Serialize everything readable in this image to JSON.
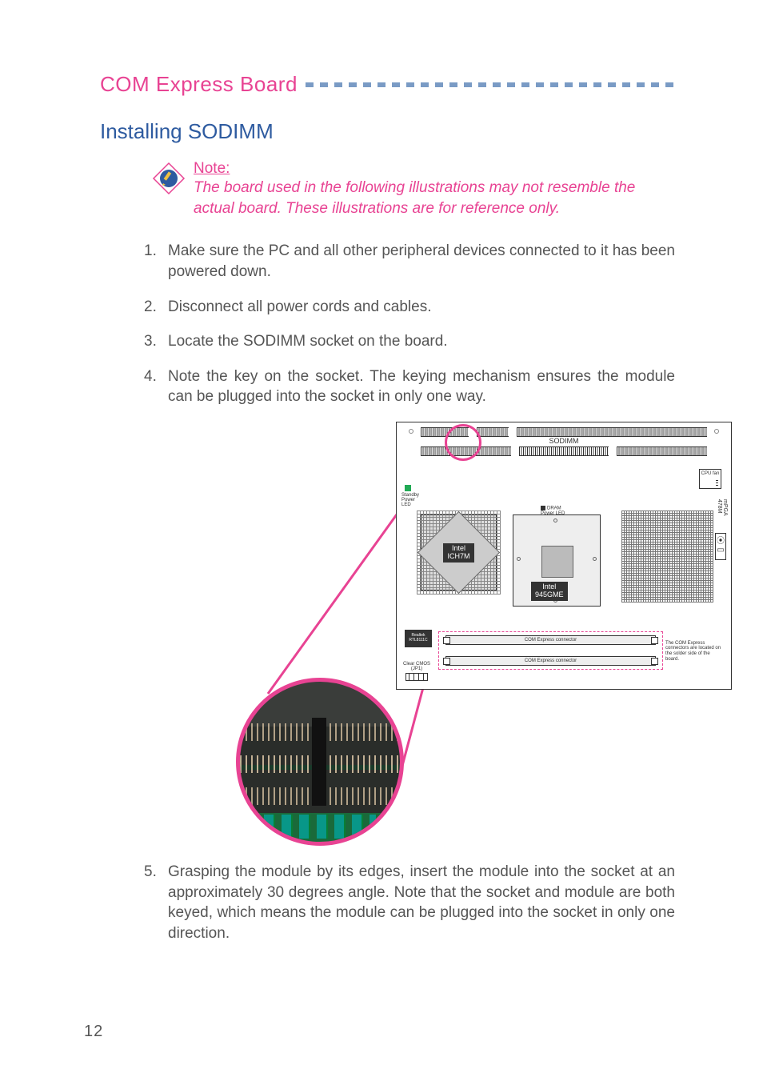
{
  "header": {
    "title": "COM Express Board"
  },
  "section": {
    "title": "Installing SODIMM"
  },
  "note": {
    "label": "Note:",
    "body": "The board used in the following illustrations may not resemble the actual board. These illustrations are for reference only."
  },
  "steps": [
    {
      "num": "1.",
      "text": "Make sure the PC and all other peripheral devices connected to it has been powered down."
    },
    {
      "num": "2.",
      "text": "Disconnect all power cords and cables."
    },
    {
      "num": "3.",
      "text": "Locate the SODIMM socket on the board."
    },
    {
      "num": "4.",
      "text": "Note the key on the socket. The keying mechanism ensures the module can be plugged into the socket in only one way."
    },
    {
      "num": "5.",
      "text": "Grasping the module by its edges, insert the module into the socket at an approximately 30 degrees angle. Note that the socket and module are both keyed, which means the module can be plugged into the socket in only one direction."
    }
  ],
  "diagram": {
    "sodimm_label": "SODIMM",
    "ich_label": "Intel\nICH7M",
    "gme_label": "Intel\n945GME",
    "cpu_fan_label": "CPU fan",
    "mpga_label": "mPGA\n478M",
    "dram_led_label": "DRAM\nPower LED",
    "standby_led_label": "Standby\nPower\nLED",
    "realtek_label": "Realtek\nRTL8111C",
    "cmos_label": "Clear CMOS\n(JP1)",
    "comx_conn_label": "COM Express connector",
    "comx_note": "The COM Express connectors are located on the solder side of the board."
  },
  "page_number": "12"
}
